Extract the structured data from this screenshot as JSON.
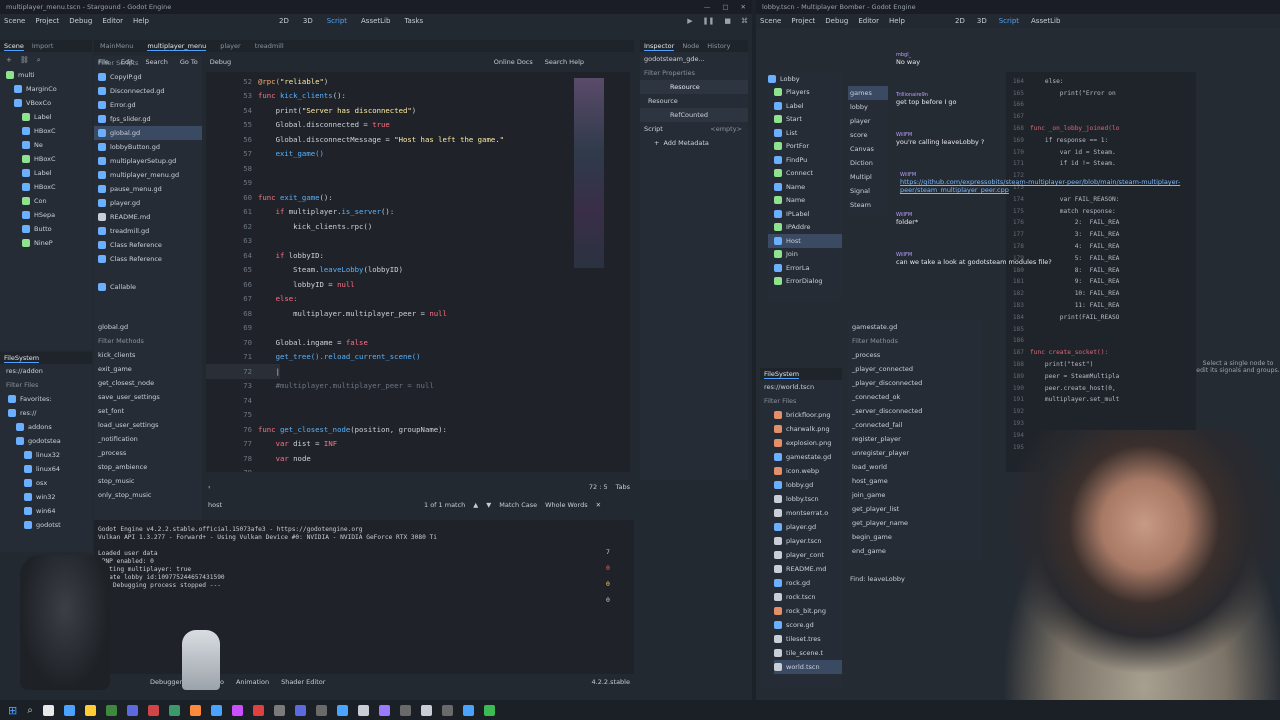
{
  "left_window": {
    "title": "multiplayer_menu.tscn - Stargound - Godot Engine",
    "menu": [
      "Scene",
      "Project",
      "Debug",
      "Editor",
      "Help"
    ],
    "workspace": [
      "2D",
      "3D",
      "Script",
      "AssetLib",
      "Tasks"
    ],
    "dock_tabs": [
      "Scene",
      "Import"
    ],
    "script_tabs": [
      "MainMenu",
      "multiplayer_menu",
      "player",
      "treadmill"
    ],
    "script_menu": [
      "File",
      "Edit",
      "Search",
      "Go To",
      "Debug"
    ],
    "online_docs": "Online Docs",
    "search_help": "Search Help",
    "filter_scripts": "Filter Scripts",
    "scene_tree": [
      "multi",
      "MarginCo",
      "VBoxCo",
      "Label",
      "HBoxC",
      "Ne",
      "HBoxC",
      "Label",
      "HBoxC",
      "Con",
      "HSepa",
      "Butto",
      "NineP"
    ],
    "scripts": [
      "CopyIP.gd",
      "Disconnected.gd",
      "Error.gd",
      "fps_slider.gd",
      "global.gd",
      "lobbyButton.gd",
      "multiplayerSetup.gd",
      "multiplayer_menu.gd",
      "pause_menu.gd",
      "player.gd",
      "README.md",
      "treadmill.gd",
      "Class Reference",
      "Class Reference",
      "",
      "Callable"
    ],
    "current_script": "global.gd",
    "filter_methods": "Filter Methods",
    "methods": [
      "kick_clients",
      "exit_game",
      "get_closest_node",
      "save_user_settings",
      "set_font",
      "load_user_settings",
      "_notification",
      "_process",
      "stop_ambience",
      "stop_music",
      "only_stop_music"
    ],
    "filesystem_label": "FileSystem",
    "res_path": "res://addon",
    "filter_files": "Filter Files",
    "fs_tree": [
      "Favorites:",
      "res://",
      "addons",
      "godotstea",
      "linux32",
      "linux64",
      "osx",
      "win32",
      "win64",
      "godotst"
    ],
    "code_lines": [
      {
        "n": "52",
        "t": [
          [
            "@rpc(",
            "c-dec"
          ],
          [
            "\"reliable\"",
            "c-str"
          ],
          [
            ")",
            "c-id"
          ]
        ]
      },
      {
        "n": "53",
        "t": [
          [
            "func ",
            "c-kw"
          ],
          [
            "kick_clients",
            "c-fn"
          ],
          [
            "():",
            "c-id"
          ]
        ]
      },
      {
        "n": "54",
        "t": [
          [
            "    print(",
            "c-id"
          ],
          [
            "\"Server has disconnected\"",
            "c-str"
          ],
          [
            ")",
            "c-id"
          ]
        ]
      },
      {
        "n": "55",
        "t": [
          [
            "    Global.disconnected = ",
            "c-id"
          ],
          [
            "true",
            "c-bool"
          ]
        ]
      },
      {
        "n": "56",
        "t": [
          [
            "    Global.disconnectMessage = ",
            "c-id"
          ],
          [
            "\"Host has left the game.\"",
            "c-str"
          ]
        ]
      },
      {
        "n": "57",
        "t": [
          [
            "    exit_game()",
            "c-fn"
          ]
        ]
      },
      {
        "n": "58",
        "t": []
      },
      {
        "n": "59",
        "t": []
      },
      {
        "n": "60",
        "t": [
          [
            "func ",
            "c-kw"
          ],
          [
            "exit_game",
            "c-fn"
          ],
          [
            "():",
            "c-id"
          ]
        ]
      },
      {
        "n": "61",
        "t": [
          [
            "    if ",
            "c-kw"
          ],
          [
            "multiplayer.",
            "c-id"
          ],
          [
            "is_server",
            "c-fn"
          ],
          [
            "():",
            "c-id"
          ]
        ]
      },
      {
        "n": "62",
        "t": [
          [
            "        kick_clients.rpc()",
            "c-id"
          ]
        ]
      },
      {
        "n": "63",
        "t": []
      },
      {
        "n": "64",
        "t": [
          [
            "    if ",
            "c-kw"
          ],
          [
            "lobbyID:",
            "c-id"
          ]
        ]
      },
      {
        "n": "65",
        "t": [
          [
            "        Steam.",
            "c-id"
          ],
          [
            "leaveLobby",
            "c-fn"
          ],
          [
            "(lobbyID)",
            "c-id"
          ]
        ]
      },
      {
        "n": "66",
        "t": [
          [
            "        lobbyID = ",
            "c-id"
          ],
          [
            "null",
            "c-bool"
          ]
        ]
      },
      {
        "n": "67",
        "t": [
          [
            "    else:",
            "c-kw"
          ]
        ]
      },
      {
        "n": "68",
        "t": [
          [
            "        multiplayer.multiplayer_peer = ",
            "c-id"
          ],
          [
            "null",
            "c-bool"
          ]
        ]
      },
      {
        "n": "69",
        "t": []
      },
      {
        "n": "70",
        "t": [
          [
            "    Global.ingame = ",
            "c-id"
          ],
          [
            "false",
            "c-bool"
          ]
        ]
      },
      {
        "n": "71",
        "t": [
          [
            "    get_tree().reload_current_scene()",
            "c-fn"
          ]
        ]
      },
      {
        "n": "72",
        "t": [
          [
            "    |",
            "c-id"
          ]
        ]
      },
      {
        "n": "73",
        "t": [
          [
            "    #multiplayer.multiplayer_peer = null",
            "c-cm"
          ]
        ]
      },
      {
        "n": "74",
        "t": []
      },
      {
        "n": "75",
        "t": []
      },
      {
        "n": "76",
        "t": [
          [
            "func ",
            "c-kw"
          ],
          [
            "get_closest_node",
            "c-fn"
          ],
          [
            "(position, groupName):",
            "c-id"
          ]
        ]
      },
      {
        "n": "77",
        "t": [
          [
            "    var ",
            "c-kw"
          ],
          [
            "dist = ",
            "c-id"
          ],
          [
            "INF",
            "c-bool"
          ]
        ]
      },
      {
        "n": "78",
        "t": [
          [
            "    var ",
            "c-kw"
          ],
          [
            "node",
            "c-id"
          ]
        ]
      },
      {
        "n": "79",
        "t": []
      }
    ],
    "cursor_pos": "72 :     5",
    "tabs_label": "Tabs",
    "find_text": "host",
    "match_count": "1 of 1 match",
    "match_case": "Match Case",
    "whole_words": "Whole Words",
    "output": [
      "Godot Engine v4.2.2.stable.official.15073afe3 - https://godotengine.org",
      "Vulkan API 1.3.277 - Forward+ - Using Vulkan Device #0: NVIDIA - NVIDIA GeForce RTX 3080 Ti",
      "",
      "Loaded user data",
      "UPNP enabled: 0",
      "Hosting multiplayer: true",
      "Create lobby id:109775244657431590",
      "--- Debugging process stopped ---"
    ],
    "counts": [
      "7",
      "0",
      "0",
      "0"
    ],
    "bottom_tabs": [
      "Debugger (4)",
      "Audio",
      "Animation",
      "Shader Editor"
    ],
    "version": "4.2.2.stable",
    "inspector_tabs": [
      "Inspector",
      "Node",
      "History"
    ],
    "inspector_file": "godotsteam_gde...",
    "filter_props": "Filter Properties",
    "resource": "Resource",
    "ref_counted": "RefCounted",
    "script_label": "Script",
    "empty": "<empty>",
    "add_metadata": "Add Metadata"
  },
  "right_window": {
    "title": "lobby.tscn - Multiplayer Bomber - Godot Engine",
    "menu": [
      "Scene",
      "Project",
      "Debug",
      "Editor",
      "Help"
    ],
    "workspace": [
      "2D",
      "3D",
      "Script",
      "AssetLib"
    ],
    "scene_tree": [
      "Lobby",
      "Players",
      "Label",
      "Start",
      "List",
      "PortFor",
      "FindPu",
      "Connect",
      "Name",
      "Name",
      "IPLabel",
      "IPAddre",
      "Host",
      "Join",
      "ErrorLa",
      "ErrorDialog"
    ],
    "scripts": [
      "games",
      "lobby",
      "player",
      "score",
      "Canvas",
      "Diction",
      "Multipl",
      "Signal",
      "Steam"
    ],
    "current_script": "gamestate.gd",
    "filter_methods": "Filter Methods",
    "methods": [
      "_process",
      "_player_connected",
      "_player_disconnected",
      "_connected_ok",
      "_server_disconnected",
      "_connected_fail",
      "register_player",
      "unregister_player",
      "load_world",
      "host_game",
      "join_game",
      "get_player_list",
      "get_player_name",
      "begin_game",
      "end_game"
    ],
    "find": "Find: leaveLobby",
    "filesystem_label": "FileSystem",
    "res_path": "res://world.tscn",
    "filter_files": "Filter Files",
    "files": [
      "brickfloor.png",
      "charwalk.png",
      "explosion.png",
      "gamestate.gd",
      "icon.webp",
      "lobby.gd",
      "lobby.tscn",
      "montserrat.o",
      "player.gd",
      "player.tscn",
      "player_cont",
      "README.md",
      "rock.gd",
      "rock.tscn",
      "rock_bit.png",
      "score.gd",
      "tileset.tres",
      "tile_scene.t",
      "world.tscn"
    ],
    "code_snippets": [
      {
        "n": "164",
        "t": "    else:"
      },
      {
        "n": "165",
        "t": "        print(\"Error on"
      },
      {
        "n": "166",
        "t": ""
      },
      {
        "n": "167",
        "t": ""
      },
      {
        "n": "168",
        "t": "func _on_lobby_joined(lo"
      },
      {
        "n": "169",
        "t": "    if response == 1:"
      },
      {
        "n": "170",
        "t": "        var id = Steam."
      },
      {
        "n": "171",
        "t": "        if id != Steam."
      },
      {
        "n": "172",
        "t": ""
      },
      {
        "n": "173",
        "t": ""
      },
      {
        "n": "174",
        "t": "        var FAIL_REASON:"
      },
      {
        "n": "175",
        "t": "        match response:"
      },
      {
        "n": "176",
        "t": "            2:  FAIL_REA"
      },
      {
        "n": "177",
        "t": "            3:  FAIL_REA"
      },
      {
        "n": "178",
        "t": "            4:  FAIL_REA"
      },
      {
        "n": "179",
        "t": "            5:  FAIL_REA"
      },
      {
        "n": "180",
        "t": "            8:  FAIL_REA"
      },
      {
        "n": "181",
        "t": "            9:  FAIL_REA"
      },
      {
        "n": "182",
        "t": "            10: FAIL_REA"
      },
      {
        "n": "183",
        "t": "            11: FAIL_REA"
      },
      {
        "n": "184",
        "t": "        print(FAIL_REASO"
      },
      {
        "n": "185",
        "t": ""
      },
      {
        "n": "186",
        "t": ""
      },
      {
        "n": "187",
        "t": "func create_socket():"
      },
      {
        "n": "188",
        "t": "    print(\"test\")"
      },
      {
        "n": "189",
        "t": "    peer = SteamMultipla"
      },
      {
        "n": "190",
        "t": "    peer.create_host(0,"
      },
      {
        "n": "191",
        "t": "    multiplayer.set_mult"
      },
      {
        "n": "192",
        "t": ""
      },
      {
        "n": "193",
        "t": ""
      },
      {
        "n": "194",
        "t": ""
      },
      {
        "n": "195",
        "t": ""
      }
    ],
    "inspector_hint": "Select a single node to edit its signals and groups."
  },
  "chat": [
    {
      "user": "mbgl_",
      "msg": "No way"
    },
    {
      "user": "Trillionaire9n",
      "msg": "get top before I go"
    },
    {
      "user": "WillFM",
      "msg": "you're calling leaveLobby ?"
    },
    {
      "user": "WillFM",
      "msg": "https://github.com/expressobits/steam-multiplayer-peer/blob/main/steam-multiplayer-peer/steam_multiplayer_peer.cpp"
    },
    {
      "user": "WillFM",
      "msg": "folder*"
    },
    {
      "user": "WillFM",
      "msg": "can we take a look at godotsteam modules file?"
    }
  ],
  "colors": {
    "accent": "#4aa3ff",
    "keyword": "#ff7085",
    "function": "#57b3ff",
    "string": "#ffeda1",
    "selection": "#3a4a63"
  }
}
